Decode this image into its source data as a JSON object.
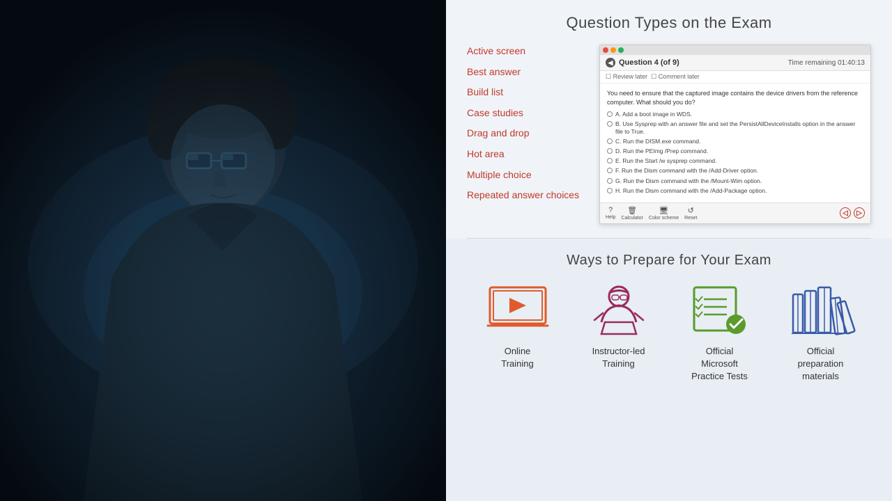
{
  "photo": {
    "alt": "Person looking at a screen in the dark"
  },
  "questionTypes": {
    "title": "Question Types on the Exam",
    "items": [
      {
        "label": "Active screen",
        "id": "active-screen"
      },
      {
        "label": "Best answer",
        "id": "best-answer"
      },
      {
        "label": "Build list",
        "id": "build-list"
      },
      {
        "label": "Case studies",
        "id": "case-studies"
      },
      {
        "label": "Drag and drop",
        "id": "drag-and-drop"
      },
      {
        "label": "Hot area",
        "id": "hot-area"
      },
      {
        "label": "Multiple choice",
        "id": "multiple-choice"
      },
      {
        "label": "Repeated answer choices",
        "id": "repeated-answer-choices"
      }
    ]
  },
  "examMockup": {
    "titlebar_buttons": [
      "red",
      "yellow",
      "green"
    ],
    "question_num": "Question 4 (of 9)",
    "time_label": "Time remaining",
    "time_value": "01:40:13",
    "checkboxes": [
      "Review later",
      "Comment later"
    ],
    "question_text": "You need to ensure that the captured image contains the device drivers from the reference computer. What should you do?",
    "options": [
      {
        "letter": "A",
        "text": "Add a boot image in WDS."
      },
      {
        "letter": "B",
        "text": "Use Sysprep with an answer file and set the PersistAllDeviceInstalls option in the answer file to True."
      },
      {
        "letter": "C",
        "text": "Run the DISM.exe command."
      },
      {
        "letter": "D",
        "text": "Run the PEImg /Prep command."
      },
      {
        "letter": "E",
        "text": "Run the Start /w sysprep command."
      },
      {
        "letter": "F",
        "text": "Run the Dism command with the /Add-Driver option."
      },
      {
        "letter": "G",
        "text": "Run the Dism command with the /Mount-Wim option."
      },
      {
        "letter": "H",
        "text": "Run the Dism command with the /Add-Package option."
      }
    ],
    "footer_items": [
      {
        "symbol": "?",
        "label": "Help"
      },
      {
        "symbol": "🗑",
        "label": "Calculator"
      },
      {
        "symbol": "🖥",
        "label": "Color scheme"
      },
      {
        "symbol": "↺",
        "label": "Reset"
      }
    ],
    "nav_buttons": [
      "◁",
      "▷"
    ]
  },
  "prepare": {
    "title": "Ways to Prepare for Your Exam",
    "items": [
      {
        "label": "Online\nTraining",
        "icon": "laptop-play-icon",
        "color": "#e05a2b"
      },
      {
        "label": "Instructor-led\nTraining",
        "icon": "instructor-icon",
        "color": "#9b2b5a"
      },
      {
        "label": "Official\nMicrosoft\nPractice Tests",
        "icon": "checklist-icon",
        "color": "#5a9b2b"
      },
      {
        "label": "Official\npreparation\nmaterials",
        "icon": "books-icon",
        "color": "#2b5a9b"
      }
    ]
  }
}
